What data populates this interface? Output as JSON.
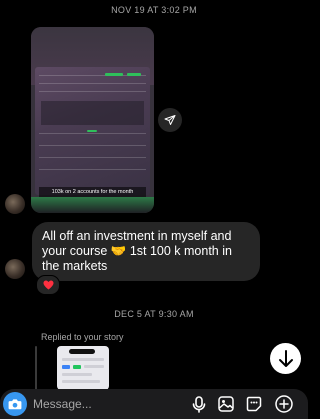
{
  "thread": {
    "timestamp_1": "NOV 19 AT 3:02 PM",
    "timestamp_2": "DEC 5 AT 9:30 AM"
  },
  "video_message": {
    "caption": "103k on 2 accounts for the month",
    "thumb_badge": "Monthly P/L  103 ...",
    "icons": [
      "play-icon",
      "share-icon"
    ]
  },
  "text_message": {
    "text": "All off an investment in myself and your course 🤝 1st 100 k month in the markets",
    "reaction": "❤️"
  },
  "story_reply": {
    "label": "Replied to your story"
  },
  "composer": {
    "placeholder": "Message...",
    "icons": [
      "camera-icon",
      "microphone-icon",
      "gallery-icon",
      "sticker-icon",
      "plus-icon"
    ]
  },
  "colors": {
    "background": "#000000",
    "bubble": "#262626",
    "accent_blue": "#3797f0",
    "reaction_red": "#ff3040",
    "chart_green": "#2fbf5b"
  }
}
